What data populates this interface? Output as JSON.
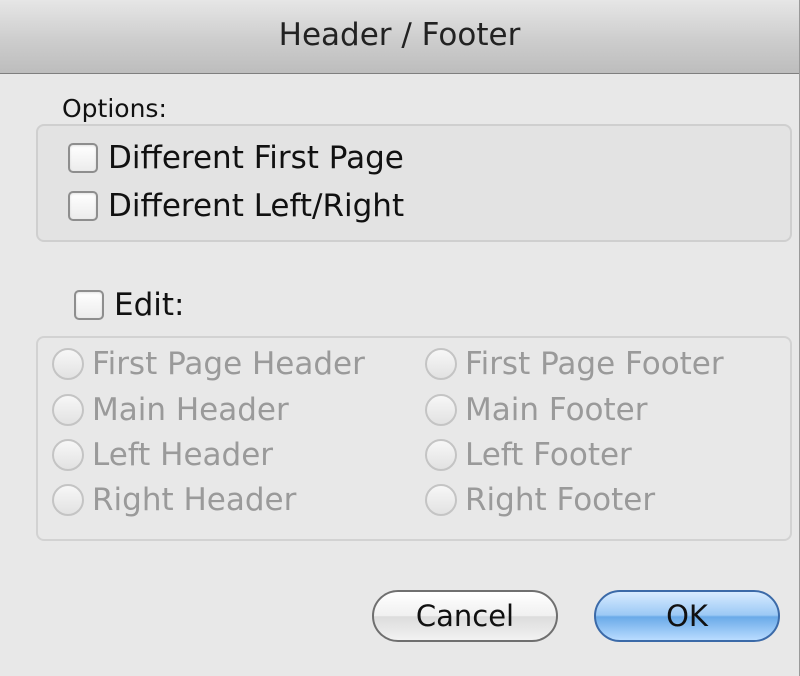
{
  "window": {
    "title": "Header / Footer"
  },
  "options": {
    "label": "Options:",
    "checkboxes": [
      {
        "label": "Different First Page",
        "checked": false
      },
      {
        "label": "Different Left/Right",
        "checked": false
      }
    ]
  },
  "edit": {
    "label": "Edit:",
    "checked": false,
    "radios": {
      "left": [
        "First Page Header",
        "Main Header",
        "Left Header",
        "Right Header"
      ],
      "right": [
        "First Page Footer",
        "Main Footer",
        "Left Footer",
        "Right Footer"
      ]
    },
    "disabled": true
  },
  "buttons": {
    "cancel": "Cancel",
    "ok": "OK"
  },
  "colors": {
    "ok_button": "#6aaae8",
    "disabled_text": "#9a9a9a"
  }
}
